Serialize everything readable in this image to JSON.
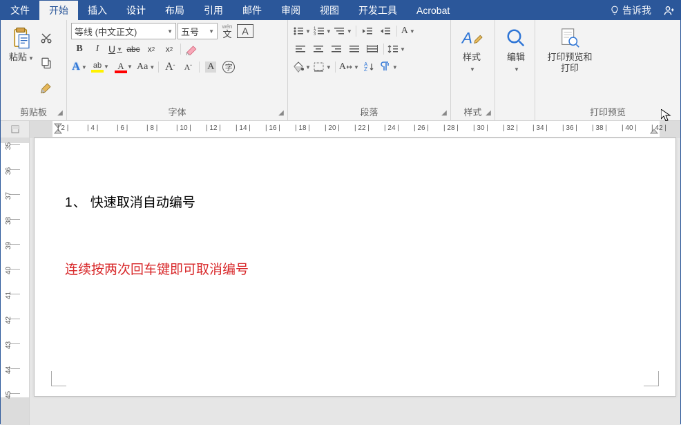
{
  "tabs": {
    "file": "文件",
    "home": "开始",
    "insert": "插入",
    "design": "设计",
    "layout": "布局",
    "references": "引用",
    "mailings": "邮件",
    "review": "审阅",
    "view": "视图",
    "developer": "开发工具",
    "acrobat": "Acrobat",
    "tell_me": "告诉我"
  },
  "groups": {
    "clipboard": {
      "label": "剪贴板",
      "paste": "粘贴"
    },
    "font": {
      "label": "字体",
      "font_name": "等线 (中文正文)",
      "font_size": "五号",
      "phonetic": "wén",
      "bold": "B",
      "italic": "I",
      "underline": "U",
      "strike": "abc",
      "sub": "x",
      "sup": "x",
      "clear_format_icon": "clear",
      "text_effect": "A",
      "highlight": "a",
      "font_color": "A",
      "phonetic2": "Aa",
      "grow": "A",
      "shrink": "A",
      "shading_A": "A",
      "enclose": "字"
    },
    "paragraph": {
      "label": "段落"
    },
    "styles": {
      "label": "样式",
      "btn": "样式"
    },
    "editing": {
      "btn": "编辑"
    },
    "print": {
      "label": "打印预览",
      "btn_line1": "打印预览和",
      "btn_line2": "打印"
    }
  },
  "ruler": {
    "h": [
      "2",
      "4",
      "6",
      "8",
      "10",
      "12",
      "14",
      "16",
      "18",
      "20",
      "22",
      "24",
      "26",
      "28",
      "30",
      "32",
      "34",
      "36",
      "38",
      "40",
      "42"
    ]
  },
  "vruler": [
    "35",
    "36",
    "37",
    "38",
    "39",
    "40",
    "41",
    "42",
    "43",
    "44",
    "45"
  ],
  "doc": {
    "line1_num": "1、",
    "line1_text": "快速取消自动编号",
    "line2": "连续按两次回车键即可取消编号"
  }
}
